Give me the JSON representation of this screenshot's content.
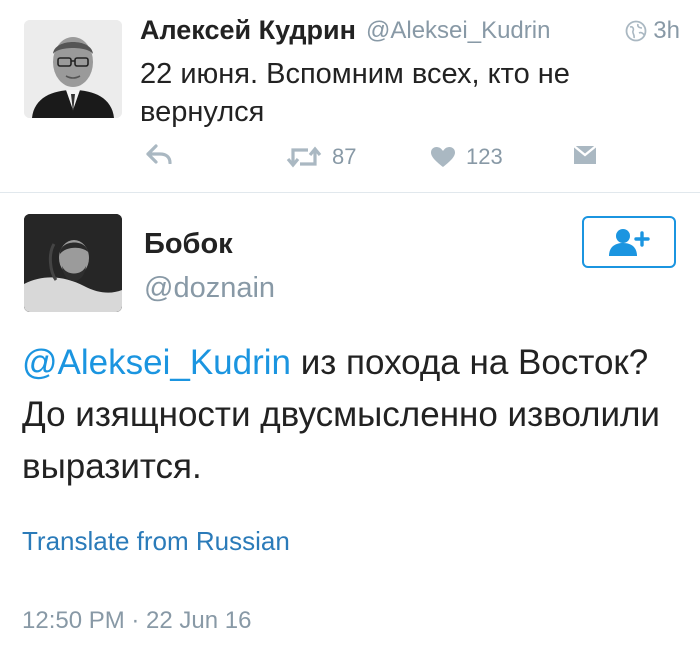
{
  "parent_tweet": {
    "author_name": "Алексей Кудрин",
    "author_handle": "@Aleksei_Kudrin",
    "time_ago": "3h",
    "text": "22 июня. Вспомним всех, кто не вернулся",
    "retweet_count": "87",
    "like_count": "123",
    "icons": [
      "globe-icon",
      "reply-icon",
      "retweet-icon",
      "heart-icon",
      "direct-message-icon"
    ]
  },
  "reply_tweet": {
    "author_name": "Бобок",
    "author_handle": "@doznain",
    "mention": "@Aleksei_Kudrin",
    "text": " из похода на Восток? До изящности двусмысленно изволили выразится.",
    "translate_label": "Translate from Russian",
    "timestamp": "12:50 PM · 22 Jun 16",
    "follow_icon": "add-user-icon"
  },
  "colors": {
    "accent": "#1b95e0",
    "link": "#2b7bb9",
    "muted": "#8899a6",
    "divider": "#e1e8ed"
  }
}
